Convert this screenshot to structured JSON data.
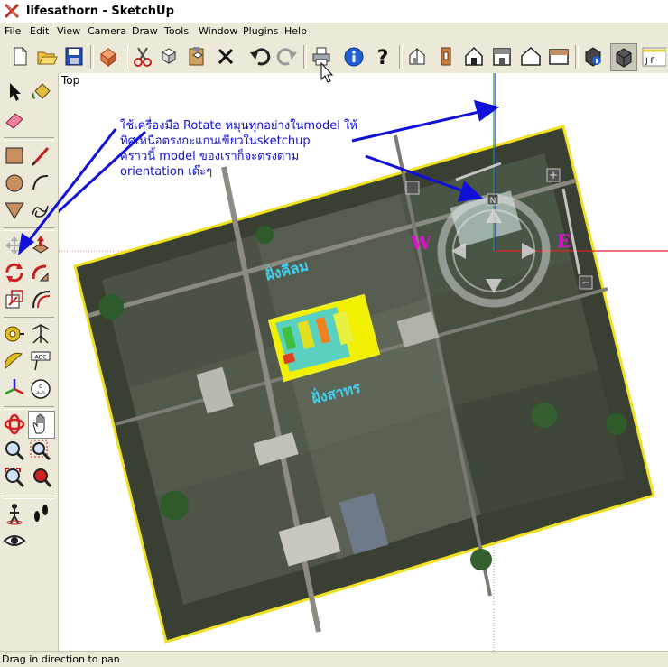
{
  "window": {
    "title": "lifesathorn - SketchUp"
  },
  "menu": {
    "items": [
      "File",
      "Edit",
      "View",
      "Camera",
      "Draw",
      "Tools",
      "Window",
      "Plugins",
      "Help"
    ]
  },
  "toolbar": {
    "buttons": [
      "new-icon",
      "open-icon",
      "save-icon",
      "make-component-icon",
      "cut-icon",
      "copy-icon",
      "paste-icon",
      "erase-icon",
      "undo-icon",
      "redo-icon",
      "print-icon",
      "model-info-icon",
      "help-icon",
      "iso-view-icon",
      "top-view-icon",
      "front-view-icon",
      "right-view-icon",
      "back-view-icon",
      "left-view-icon",
      "xray-icon",
      "hidden-line-icon"
    ],
    "partial_label": "J F"
  },
  "left_tools": {
    "tools": [
      "select-icon",
      "paint-bucket-icon",
      "eraser-icon",
      "rectangle-icon",
      "line-icon",
      "circle-icon",
      "arc-icon",
      "polygon-icon",
      "freehand-icon",
      "move-icon",
      "push-pull-icon",
      "rotate-icon",
      "follow-me-icon",
      "scale-icon",
      "offset-icon",
      "tape-measure-icon",
      "dimension-icon",
      "protractor-icon",
      "text-icon",
      "axes-icon",
      "3d-text-icon",
      "orbit-icon",
      "pan-icon",
      "zoom-icon",
      "zoom-window-icon",
      "zoom-extents-icon",
      "previous-view-icon",
      "position-camera-icon",
      "walk-icon",
      "look-around-icon"
    ]
  },
  "viewport": {
    "view_label": "Top",
    "annotation_lines": [
      "ใช้เครื่องมือ Rotate หมุนทุกอย่างในmodel ให้",
      "ทิศเหนือตรงกะแกนเขียวในsketchup",
      "คราวนี้ model ของเราก็จะตรงตาม",
      "orientation เด๊ะๆ"
    ],
    "image_labels": {
      "left_side": "ฝั่งคีลม",
      "bottom_side": "ฝั่งสาทร",
      "west": "W",
      "east": "E"
    },
    "colors": {
      "annotation": "#1010d8",
      "red_axis": "#e02020",
      "green_axis": "#20a020",
      "blue_axis": "#2020e0",
      "photo_border": "#f0e020"
    }
  },
  "status": {
    "text": "Drag in direction to pan"
  }
}
